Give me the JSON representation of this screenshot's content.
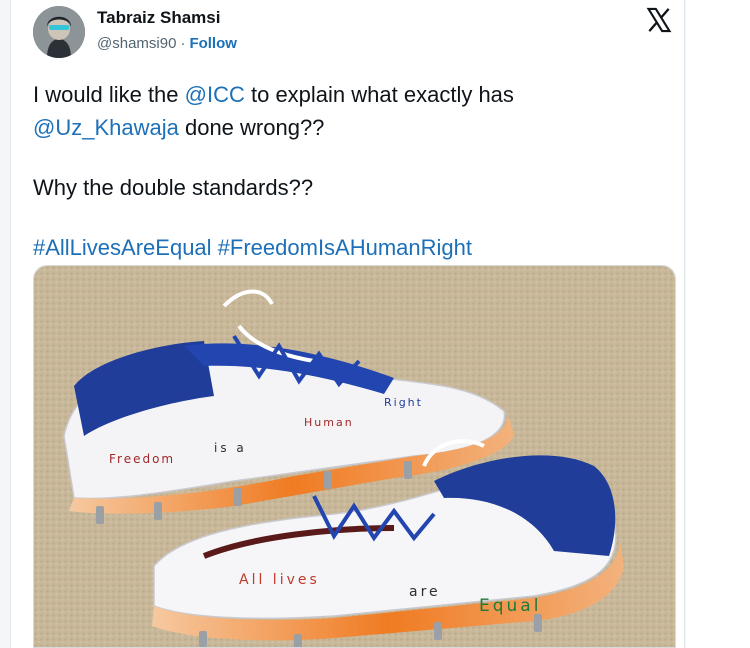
{
  "author": {
    "name": "Tabraiz Shamsi",
    "handle": "@shamsi90",
    "separator": "·",
    "follow_label": "Follow"
  },
  "tweet": {
    "line1_pre": "I would like the ",
    "mention_icc": "@ICC",
    "line1_post": "  to explain what exactly has",
    "mention_khawaja": "@Uz_Khawaja",
    "line2_post": " done wrong??",
    "line3": "Why the double standards??",
    "hashtag1": "#AllLivesAreEqual",
    "hashtag2": "#FreedomIsAHumanRight"
  },
  "media": {
    "shoe_top_text": [
      "Freedom",
      "is a",
      "Human",
      "Right"
    ],
    "shoe_bottom_text": [
      "All lives",
      "are",
      "Equal"
    ]
  },
  "colors": {
    "link": "#1d70b8",
    "text": "#0f1419",
    "muted": "#536471",
    "carpet": "#c9b99b",
    "shoe_blue": "#1f3d99",
    "shoe_orange": "#f07b22"
  },
  "icons": {
    "logo": "x-logo-icon"
  }
}
